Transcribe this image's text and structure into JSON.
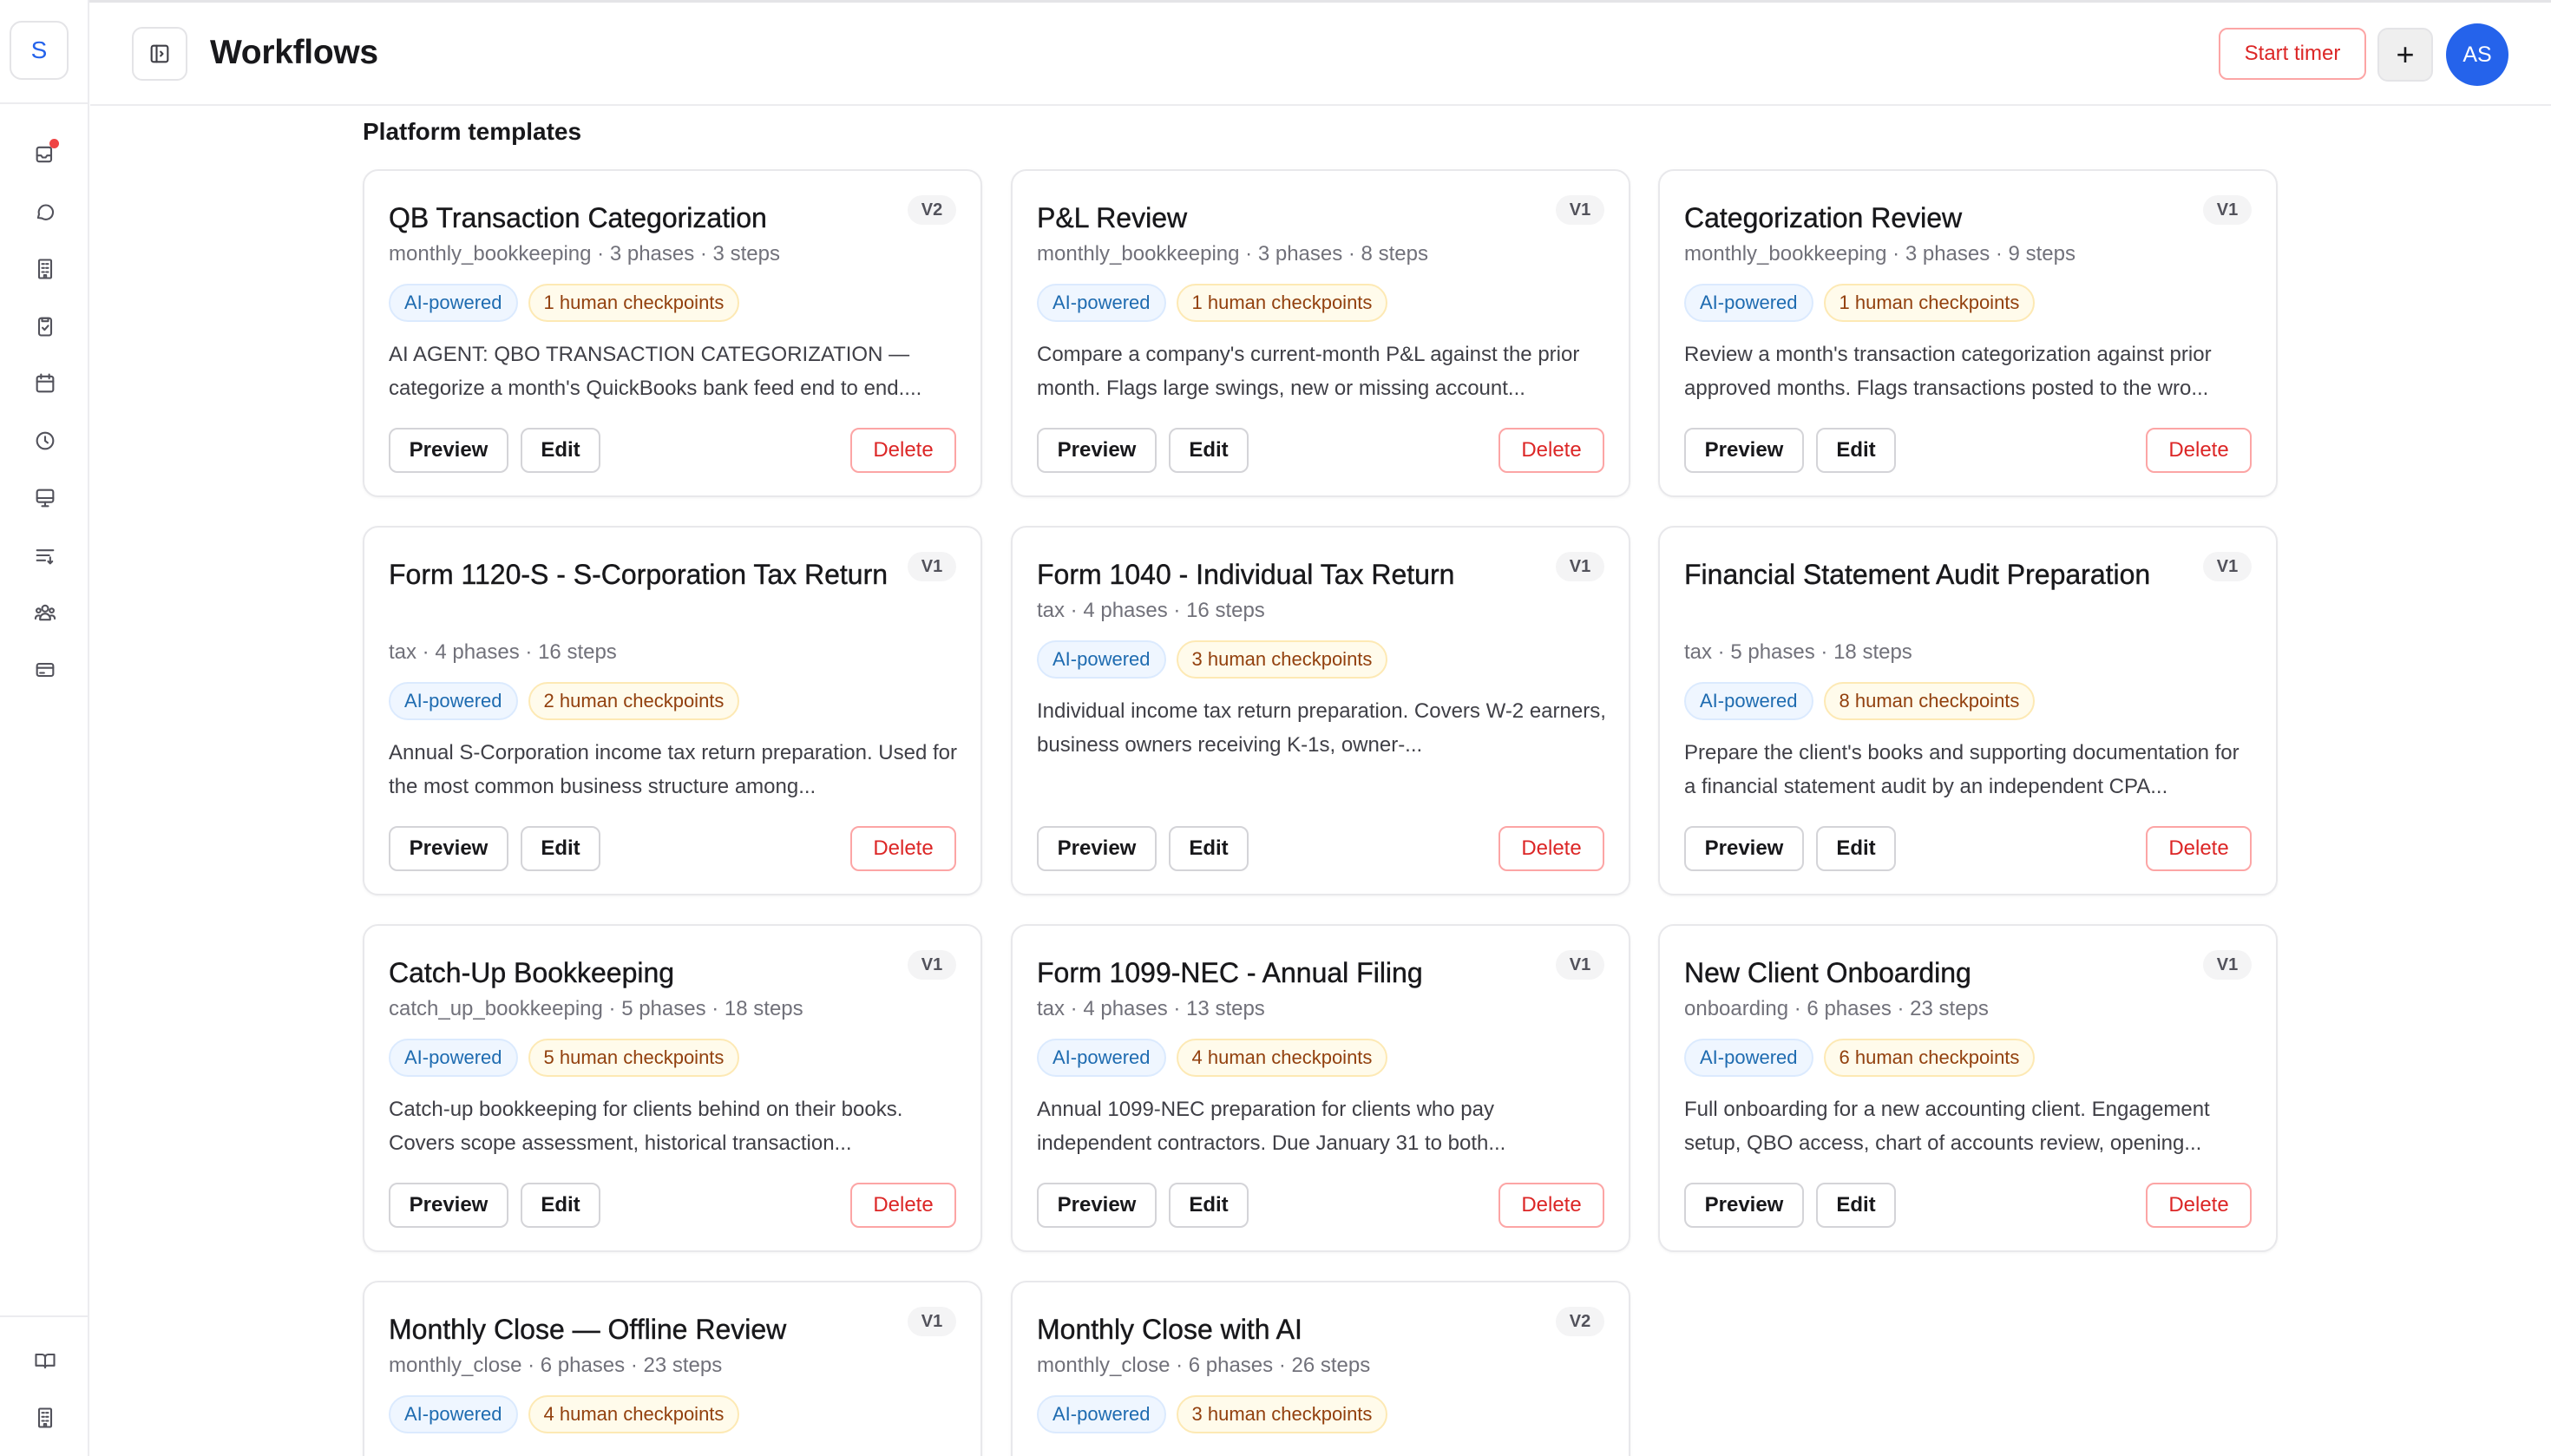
{
  "app": {
    "logo_letter": "S"
  },
  "header": {
    "title": "Workflows",
    "start_timer_label": "Start timer",
    "add_label": "+",
    "avatar_initials": "AS"
  },
  "colors": {
    "accent": "#2563eb",
    "danger": "#dc2626",
    "ai_badge": "#1e6bb0",
    "checkpoint_badge": "#92400e"
  },
  "sidebar": {
    "items": [
      {
        "icon": "inbox-icon",
        "has_notification": true
      },
      {
        "icon": "chat-icon"
      },
      {
        "icon": "building-icon"
      },
      {
        "icon": "clipboard-check-icon"
      },
      {
        "icon": "calendar-icon"
      },
      {
        "icon": "clock-icon"
      },
      {
        "icon": "monitor-icon"
      },
      {
        "icon": "list-filter-icon"
      },
      {
        "icon": "users-icon"
      },
      {
        "icon": "credit-card-icon"
      }
    ],
    "bottom_items": [
      {
        "icon": "book-icon"
      },
      {
        "icon": "building-icon"
      }
    ]
  },
  "main": {
    "section_title": "Platform templates",
    "button_labels": {
      "preview": "Preview",
      "edit": "Edit",
      "delete": "Delete"
    },
    "templates": [
      {
        "title": "QB Transaction Categorization",
        "version": "V2",
        "meta": "monthly_bookkeeping · 3 phases · 3 steps",
        "ai_badge": "AI-powered",
        "checkpoints": "1 human checkpoints",
        "description": "AI AGENT: QBO TRANSACTION CATEGORIZATION — categorize a month's QuickBooks bank feed end to end...."
      },
      {
        "title": "P&L Review",
        "version": "V1",
        "meta": "monthly_bookkeeping · 3 phases · 8 steps",
        "ai_badge": "AI-powered",
        "checkpoints": "1 human checkpoints",
        "description": "Compare a company's current-month P&L against the prior month. Flags large swings, new or missing account..."
      },
      {
        "title": "Categorization Review",
        "version": "V1",
        "meta": "monthly_bookkeeping · 3 phases · 9 steps",
        "ai_badge": "AI-powered",
        "checkpoints": "1 human checkpoints",
        "description": "Review a month's transaction categorization against prior approved months. Flags transactions posted to the wro..."
      },
      {
        "title": "Form 1120-S - S-Corporation Tax Return",
        "version": "V1",
        "meta": "tax · 4 phases · 16 steps",
        "ai_badge": "AI-powered",
        "checkpoints": "2 human checkpoints",
        "description": "Annual S-Corporation income tax return preparation. Used for the most common business structure among..."
      },
      {
        "title": "Form 1040 - Individual Tax Return",
        "version": "V1",
        "meta": "tax · 4 phases · 16 steps",
        "ai_badge": "AI-powered",
        "checkpoints": "3 human checkpoints",
        "description": "Individual income tax return preparation. Covers W-2 earners, business owners receiving K-1s, owner-..."
      },
      {
        "title": "Financial Statement Audit Preparation",
        "version": "V1",
        "meta": "tax · 5 phases · 18 steps",
        "ai_badge": "AI-powered",
        "checkpoints": "8 human checkpoints",
        "description": "Prepare the client's books and supporting documentation for a financial statement audit by an independent CPA..."
      },
      {
        "title": "Catch-Up Bookkeeping",
        "version": "V1",
        "meta": "catch_up_bookkeeping · 5 phases · 18 steps",
        "ai_badge": "AI-powered",
        "checkpoints": "5 human checkpoints",
        "description": "Catch-up bookkeeping for clients behind on their books. Covers scope assessment, historical transaction..."
      },
      {
        "title": "Form 1099-NEC - Annual Filing",
        "version": "V1",
        "meta": "tax · 4 phases · 13 steps",
        "ai_badge": "AI-powered",
        "checkpoints": "4 human checkpoints",
        "description": "Annual 1099-NEC preparation for clients who pay independent contractors. Due January 31 to both..."
      },
      {
        "title": "New Client Onboarding",
        "version": "V1",
        "meta": "onboarding · 6 phases · 23 steps",
        "ai_badge": "AI-powered",
        "checkpoints": "6 human checkpoints",
        "description": "Full onboarding for a new accounting client. Engagement setup, QBO access, chart of accounts review, opening..."
      },
      {
        "title": "Monthly Close — Offline Review",
        "version": "V1",
        "meta": "monthly_close · 6 phases · 23 steps",
        "ai_badge": "AI-powered",
        "checkpoints": "4 human checkpoints",
        "description": ""
      },
      {
        "title": "Monthly Close with AI",
        "version": "V2",
        "meta": "monthly_close · 6 phases · 26 steps",
        "ai_badge": "AI-powered",
        "checkpoints": "3 human checkpoints",
        "description": ""
      }
    ]
  }
}
